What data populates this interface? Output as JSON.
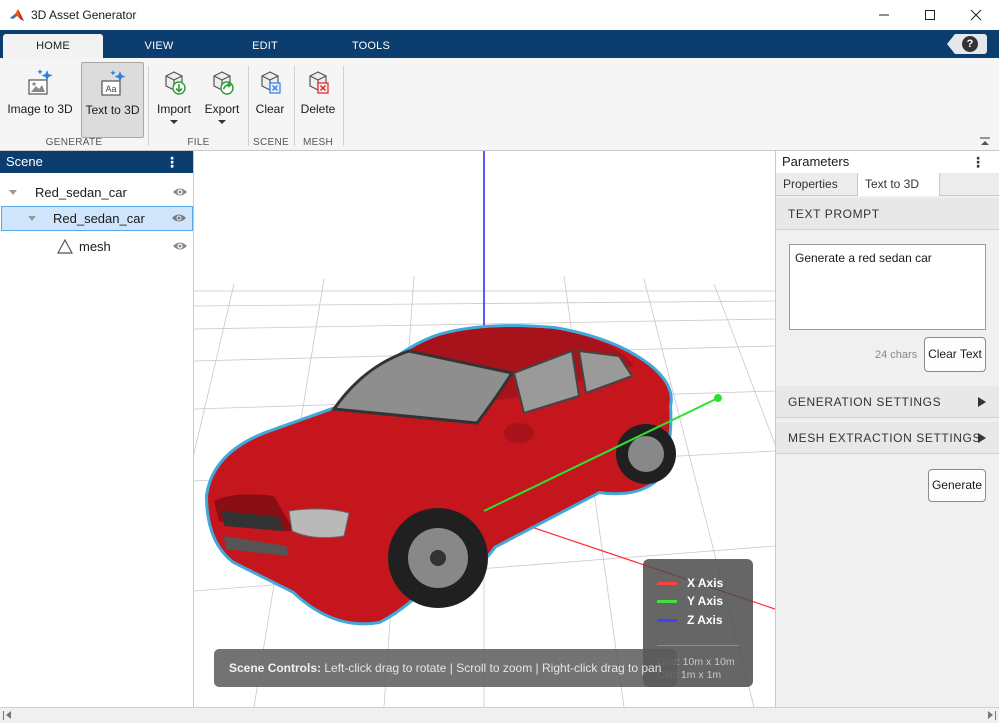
{
  "window": {
    "title": "3D Asset Generator",
    "minimize_icon": "minimize-icon",
    "maximize_icon": "maximize-icon",
    "close_icon": "close-icon"
  },
  "tabs": [
    {
      "label": "HOME",
      "active": true
    },
    {
      "label": "VIEW",
      "active": false
    },
    {
      "label": "EDIT",
      "active": false
    },
    {
      "label": "TOOLS",
      "active": false
    }
  ],
  "help": {
    "label": "?"
  },
  "ribbon": {
    "image_to_3d": "Image to 3D",
    "text_to_3d": "Text to 3D",
    "import": "Import",
    "export": "Export",
    "clear": "Clear",
    "delete": "Delete",
    "groups": {
      "generate": "GENERATE",
      "file": "FILE",
      "scene": "SCENE",
      "mesh": "MESH"
    }
  },
  "scene_panel": {
    "title": "Scene",
    "menu": "⋮",
    "items": [
      {
        "label": "Red_sedan_car",
        "level": 0,
        "selected": false
      },
      {
        "label": "Red_sedan_car",
        "level": 1,
        "selected": true
      },
      {
        "label": "mesh",
        "level": 2,
        "selected": false
      }
    ]
  },
  "viewport": {
    "legend": {
      "x_axis": "X Axis",
      "y_axis": "Y Axis",
      "z_axis": "Z Axis",
      "grid_1": "Grid: 10m x 10m",
      "grid_2": "Cell: 1m x 1m",
      "colors": {
        "x": "#ff4040",
        "y": "#40e040",
        "z": "#4040ff"
      }
    },
    "controls": {
      "label": "Scene Controls:",
      "text": "Left-click drag to rotate | Scroll to zoom | Right-click drag to pan"
    }
  },
  "parameters": {
    "title": "Parameters",
    "menu": "⋮",
    "tabs": [
      {
        "label": "Properties",
        "active": false
      },
      {
        "label": "Text to 3D",
        "active": true
      }
    ],
    "text_prompt_header": "TEXT PROMPT",
    "prompt_value": "Generate a red sedan car",
    "char_count": "24 chars",
    "clear_text": "Clear Text",
    "generation_settings": "GENERATION SETTINGS",
    "mesh_extraction_settings": "MESH EXTRACTION SETTINGS",
    "generate": "Generate"
  },
  "colors": {
    "accent": "#0b3d6e",
    "car_red": "#c4161c",
    "selection_outline": "#3fa9dc"
  }
}
